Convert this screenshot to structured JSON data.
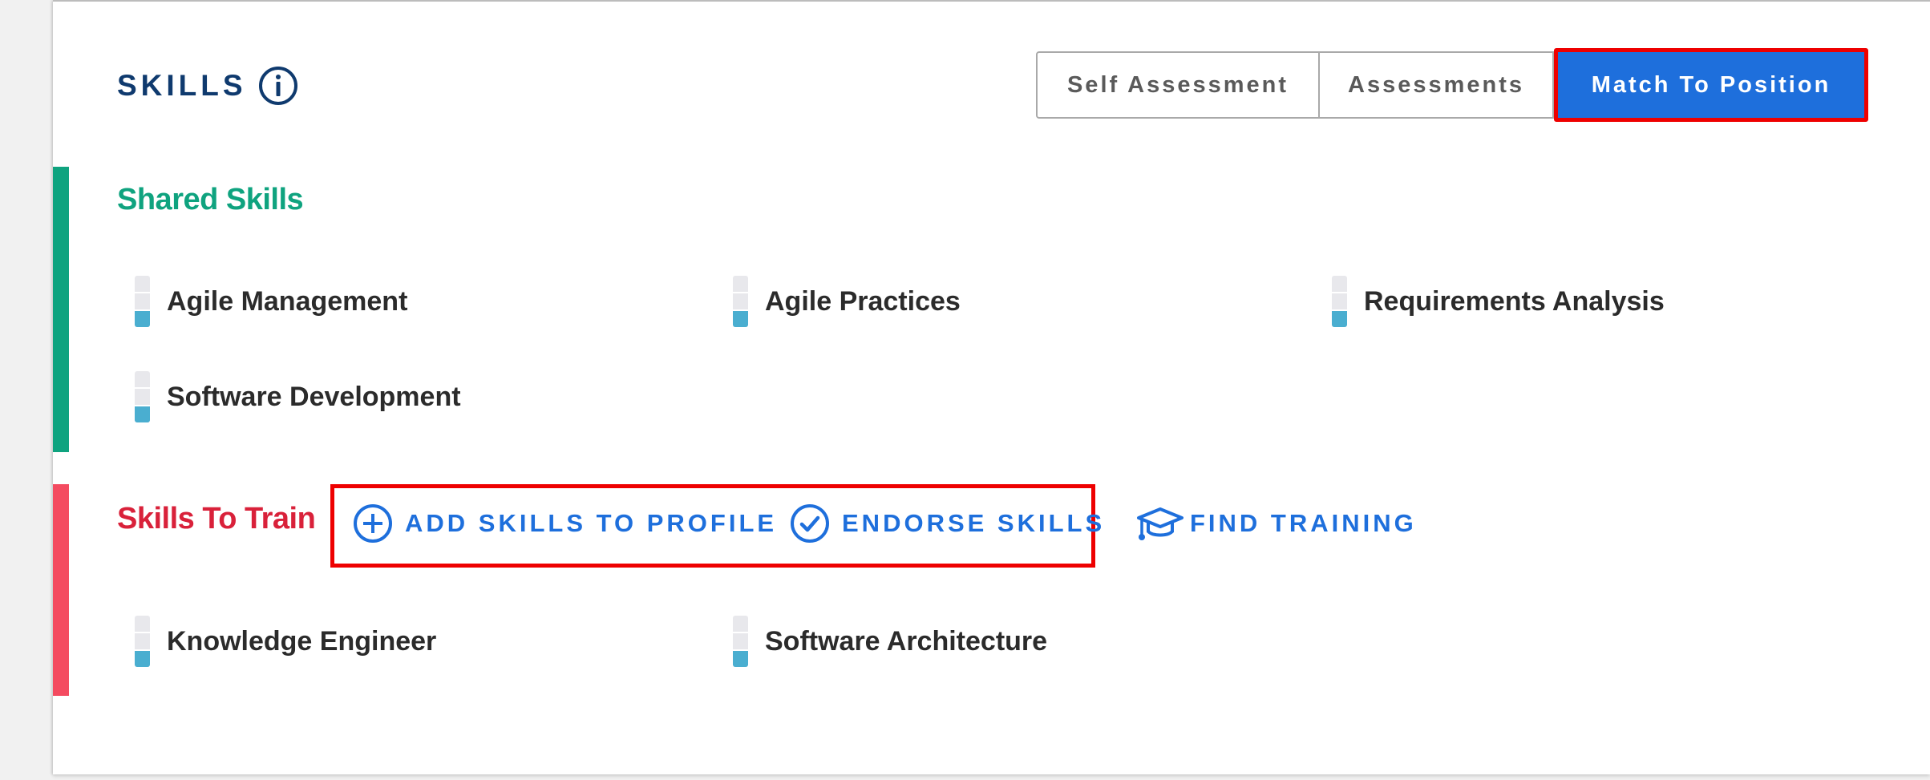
{
  "header": {
    "title": "SKILLS",
    "info_icon": "info-circle-icon"
  },
  "toggle": {
    "self_assessment": "Self Assessment",
    "assessments": "Assessments",
    "match_to_position": "Match To Position",
    "active": "match_to_position"
  },
  "shared": {
    "title": "Shared Skills",
    "accent_color": "#0fa37f",
    "skills": [
      {
        "label": "Agile Management",
        "level": 1,
        "max": 3
      },
      {
        "label": "Agile Practices",
        "level": 1,
        "max": 3
      },
      {
        "label": "Requirements Analysis",
        "level": 1,
        "max": 3
      },
      {
        "label": "Software Development",
        "level": 1,
        "max": 3
      }
    ]
  },
  "train": {
    "title": "Skills To Train",
    "accent_color": "#f44b60",
    "actions": {
      "add_skills": {
        "label": "ADD SKILLS TO PROFILE",
        "icon": "plus-circle-icon"
      },
      "endorse_skills": {
        "label": "ENDORSE SKILLS",
        "icon": "check-circle-icon"
      },
      "find_training": {
        "label": "FIND TRAINING",
        "icon": "graduation-cap-icon"
      }
    },
    "skills": [
      {
        "label": "Knowledge Engineer",
        "level": 1,
        "max": 3
      },
      {
        "label": "Software Architecture",
        "level": 1,
        "max": 3
      }
    ]
  },
  "colors": {
    "primary": "#1e6fdc",
    "title_navy": "#0f3a6e",
    "meter_fill": "#4aaed0",
    "highlight": "#ee0000"
  }
}
